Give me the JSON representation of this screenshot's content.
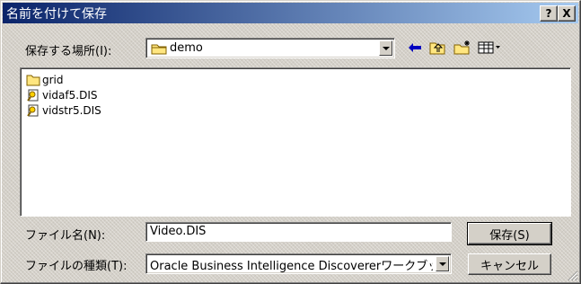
{
  "window": {
    "title": "名前を付けて保存",
    "help_label": "?",
    "close_label": "X"
  },
  "location": {
    "label": "保存する場所(I):",
    "value": "demo"
  },
  "files": [
    {
      "name": "grid",
      "type": "folder"
    },
    {
      "name": "vidaf5.DIS",
      "type": "file"
    },
    {
      "name": "vidstr5.DIS",
      "type": "file"
    }
  ],
  "filename": {
    "label": "ファイル名(N):",
    "value": "Video.DIS"
  },
  "filetype": {
    "label": "ファイルの種類(T):",
    "value": "Oracle Business Intelligence Discovererワークブッ"
  },
  "buttons": {
    "save": "保存(S)",
    "cancel": "キャンセル"
  },
  "icons": {
    "back": "back-arrow-icon",
    "up": "up-folder-icon",
    "new_folder": "new-folder-icon",
    "view": "view-menu-icon"
  }
}
